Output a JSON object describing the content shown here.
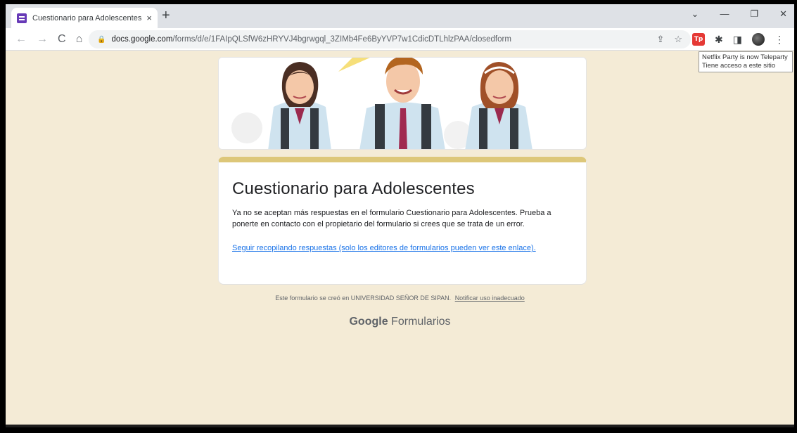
{
  "tab": {
    "title": "Cuestionario para Adolescentes",
    "close": "×",
    "new_tab": "+"
  },
  "window_controls": {
    "dropdown": "⌄",
    "minimize": "—",
    "restore": "❐",
    "close": "✕"
  },
  "nav": {
    "back": "←",
    "forward": "→",
    "reload": "C",
    "home": "⌂"
  },
  "address": {
    "lock": "🔒",
    "host": "docs.google.com",
    "path": "/forms/d/e/1FAIpQLSfW6zHRYVJ4bgrwgql_3ZIMb4Fe6ByYVP7w1CdicDTLhlzPAA/closedform"
  },
  "omnibox_icons": {
    "share": "⇪",
    "star": "☆"
  },
  "extensions": {
    "teleparty": "Tp",
    "puzzle": "✱",
    "sidepanel": "◨",
    "menu": "⋮"
  },
  "tooltip": {
    "line1": "Netflix Party is now Teleparty",
    "line2": "Tiene acceso a este sitio"
  },
  "form": {
    "title": "Cuestionario para Adolescentes",
    "message": "Ya no se aceptan más respuestas en el formulario Cuestionario para Adolescentes. Prueba a ponerte en contacto con el propietario del formulario si crees que se trata de un error.",
    "link": "Seguir recopilando respuestas (solo los editores de formularios pueden ver este enlace)."
  },
  "footer": {
    "note": "Este formulario se creó en UNIVERSIDAD SEÑOR DE SIPAN.",
    "report_link": "Notificar uso inadecuado",
    "brand_google": "Google",
    "brand_product": "Formularios"
  },
  "colors": {
    "page_bg": "#f4ebd6",
    "card_accent": "#ddc779",
    "link": "#1a73e8",
    "forms_purple": "#673ab7"
  }
}
